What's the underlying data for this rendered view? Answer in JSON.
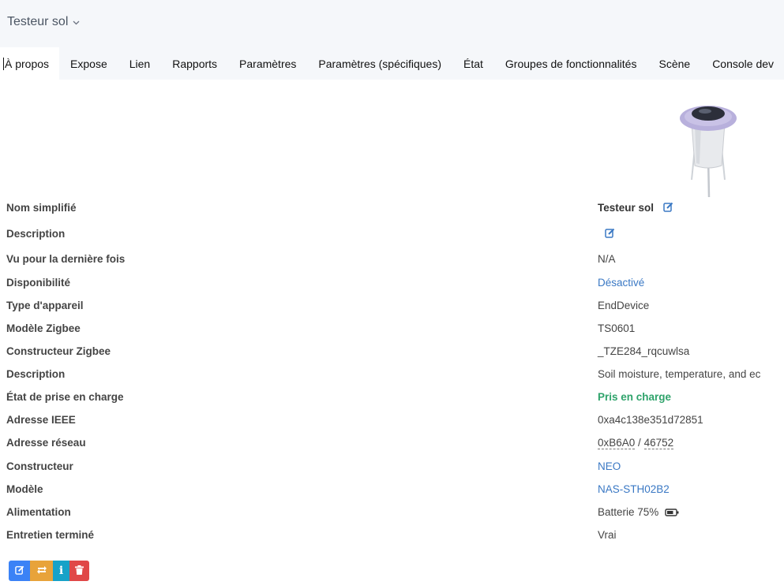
{
  "header": {
    "device_name": "Testeur sol",
    "chevron_icon": "chevron-down-icon"
  },
  "tabs": [
    {
      "label": "À propos",
      "active": true
    },
    {
      "label": "Expose"
    },
    {
      "label": "Lien"
    },
    {
      "label": "Rapports"
    },
    {
      "label": "Paramètres"
    },
    {
      "label": "Paramètres (spécifiques)"
    },
    {
      "label": "État"
    },
    {
      "label": "Groupes de fonctionnalités"
    },
    {
      "label": "Scène"
    },
    {
      "label": "Console dev"
    }
  ],
  "device_image": {
    "icon": "soil-sensor-image"
  },
  "info": {
    "friendly_name": {
      "label": "Nom simplifié",
      "value": "Testeur sol"
    },
    "description_edit": {
      "label": "Description"
    },
    "last_seen": {
      "label": "Vu pour la dernière fois",
      "value": "N/A"
    },
    "availability": {
      "label": "Disponibilité",
      "value": "Désactivé"
    },
    "device_type": {
      "label": "Type d'appareil",
      "value": "EndDevice"
    },
    "zigbee_model": {
      "label": "Modèle Zigbee",
      "value": "TS0601"
    },
    "zigbee_manufacturer": {
      "label": "Constructeur Zigbee",
      "value": "_TZE284_rqcuwlsa"
    },
    "description": {
      "label": "Description",
      "value": "Soil moisture, temperature, and ec"
    },
    "support_status": {
      "label": "État de prise en charge",
      "value": "Pris en charge"
    },
    "ieee_address": {
      "label": "Adresse IEEE",
      "value": "0xa4c138e351d72851"
    },
    "network_address": {
      "label": "Adresse réseau",
      "hex": "0xB6A0",
      "separator": " / ",
      "dec": "46752"
    },
    "manufacturer": {
      "label": "Constructeur",
      "value": "NEO"
    },
    "model": {
      "label": "Modèle",
      "value": "NAS-STH02B2"
    },
    "power_source": {
      "label": "Alimentation",
      "value": "Batterie 75%",
      "battery_level": 75
    },
    "interview_completed": {
      "label": "Entretien terminé",
      "value": "Vrai"
    }
  },
  "actions": {
    "rename_icon": "edit-icon",
    "reconfigure_icon": "refresh-icon",
    "interview_icon": "info-icon",
    "remove_icon": "trash-icon"
  },
  "colors": {
    "link": "#3a78c4",
    "success": "#2fa36b",
    "primary": "#3b82f6",
    "warning": "#e8a33a",
    "info": "#17a2c8",
    "danger": "#e04848"
  }
}
